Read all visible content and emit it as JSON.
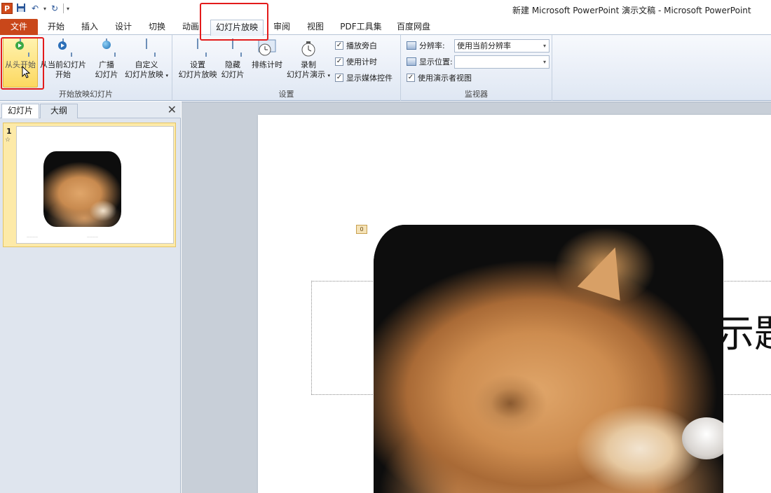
{
  "app": {
    "logo_letter": "P",
    "window_title": "新建 Microsoft PowerPoint 演示文稿 - Microsoft PowerPoint"
  },
  "tabs": [
    {
      "label": "文件"
    },
    {
      "label": "开始"
    },
    {
      "label": "插入"
    },
    {
      "label": "设计"
    },
    {
      "label": "切换"
    },
    {
      "label": "动画"
    },
    {
      "label": "幻灯片放映"
    },
    {
      "label": "审阅"
    },
    {
      "label": "视图"
    },
    {
      "label": "PDF工具集"
    },
    {
      "label": "百度网盘"
    }
  ],
  "ribbon": {
    "start_group": {
      "label": "开始放映幻灯片",
      "from_beginning": "从头开始",
      "from_current_1": "从当前幻灯片",
      "from_current_2": "开始",
      "broadcast_1": "广播",
      "broadcast_2": "幻灯片",
      "custom_1": "自定义",
      "custom_2": "幻灯片放映"
    },
    "setup_group": {
      "label": "设置",
      "setup_1": "设置",
      "setup_2": "幻灯片放映",
      "hide_1": "隐藏",
      "hide_2": "幻灯片",
      "rehearse": "排练计时",
      "record_1": "录制",
      "record_2": "幻灯片演示",
      "play_narrations": "播放旁白",
      "use_timings": "使用计时",
      "show_media_controls": "显示媒体控件"
    },
    "monitor_group": {
      "label": "监视器",
      "resolution_label": "分辨率:",
      "resolution_value": "使用当前分辨率",
      "show_on_label": "显示位置:",
      "show_on_value": "",
      "presenter_view": "使用演示者视图"
    }
  },
  "left_pane": {
    "tab_slides": "幻灯片",
    "tab_outline": "大纲",
    "close": "✕",
    "slide_number": "1",
    "slide_star": "☆"
  },
  "slide": {
    "anim_tag": "0",
    "title_fragment": "示题"
  }
}
